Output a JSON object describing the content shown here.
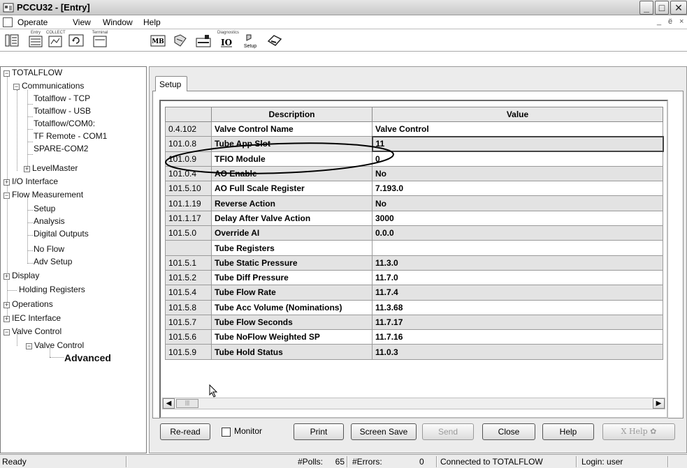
{
  "window": {
    "title": "PCCU32 - [Entry]"
  },
  "menu": {
    "items": [
      "Operate",
      "View",
      "Window",
      "Help"
    ],
    "mdi_controls": [
      "_",
      "ё",
      "×"
    ]
  },
  "toolbar": {
    "labels": {
      "entry": "Entry",
      "collect": "COLLECT",
      "terminal": "Terminal",
      "mb": "MB",
      "io": "IO",
      "diagnostics": "Diagnostics",
      "setup": "Setup"
    }
  },
  "tree": {
    "root": "TOTALFLOW",
    "communications": "Communications",
    "comm_children": [
      "Totalflow - TCP",
      "Totalflow - USB",
      "Totalflow/COM0:",
      "TF Remote - COM1",
      "SPARE-COM2"
    ],
    "levelmaster": "LevelMaster",
    "io_interface": "I/O Interface",
    "flow_measurement": "Flow Measurement",
    "flow_children": [
      "Setup",
      "Analysis",
      "Digital Outputs",
      "No Flow",
      "Adv Setup"
    ],
    "display": "Display",
    "holding_registers": "Holding Registers",
    "operations": "Operations",
    "iec_interface": "IEC Interface",
    "valve_control": "Valve Control",
    "valve_control_child": "Valve Control",
    "advanced": "Advanced"
  },
  "tab": {
    "label": "Setup"
  },
  "grid": {
    "headers": [
      "",
      "Description",
      "Value"
    ],
    "rows": [
      [
        "0.4.102",
        "Valve Control Name",
        "Valve Control"
      ],
      [
        "101.0.8",
        "Tube App Slot",
        "11"
      ],
      [
        "101.0.9",
        "TFIO Module",
        "0"
      ],
      [
        "101.0.4",
        "AO Enable",
        "No"
      ],
      [
        "101.5.10",
        "AO Full Scale Register",
        "7.193.0"
      ],
      [
        "101.1.19",
        "Reverse Action",
        "No"
      ],
      [
        "101.1.17",
        "Delay After Valve Action",
        "3000"
      ],
      [
        "101.5.0",
        "Override AI",
        "0.0.0"
      ],
      [
        "",
        "Tube Registers",
        ""
      ],
      [
        "101.5.1",
        "Tube Static Pressure",
        "11.3.0"
      ],
      [
        "101.5.2",
        "Tube Diff Pressure",
        "11.7.0"
      ],
      [
        "101.5.4",
        "Tube Flow Rate",
        "11.7.4"
      ],
      [
        "101.5.8",
        "Tube Acc Volume (Nominations)",
        "11.3.68"
      ],
      [
        "101.5.7",
        "Tube Flow Seconds",
        "11.7.17"
      ],
      [
        "101.5.6",
        "Tube NoFlow Weighted SP",
        "11.7.16"
      ],
      [
        "101.5.9",
        "Tube Hold Status",
        "11.0.3"
      ]
    ]
  },
  "buttons": {
    "reread": "Re-read",
    "monitor": "Monitor",
    "print": "Print",
    "screen_save": "Screen Save",
    "send": "Send",
    "close": "Close",
    "help": "Help",
    "xhelp": "X Help"
  },
  "status": {
    "ready": "Ready",
    "polls_label": "#Polls:",
    "polls_value": "65",
    "errors_label": "#Errors:",
    "errors_value": "0",
    "connected": "Connected to TOTALFLOW",
    "login": "Login: user"
  },
  "colors": {
    "highlight_ellipse": "#000000"
  }
}
